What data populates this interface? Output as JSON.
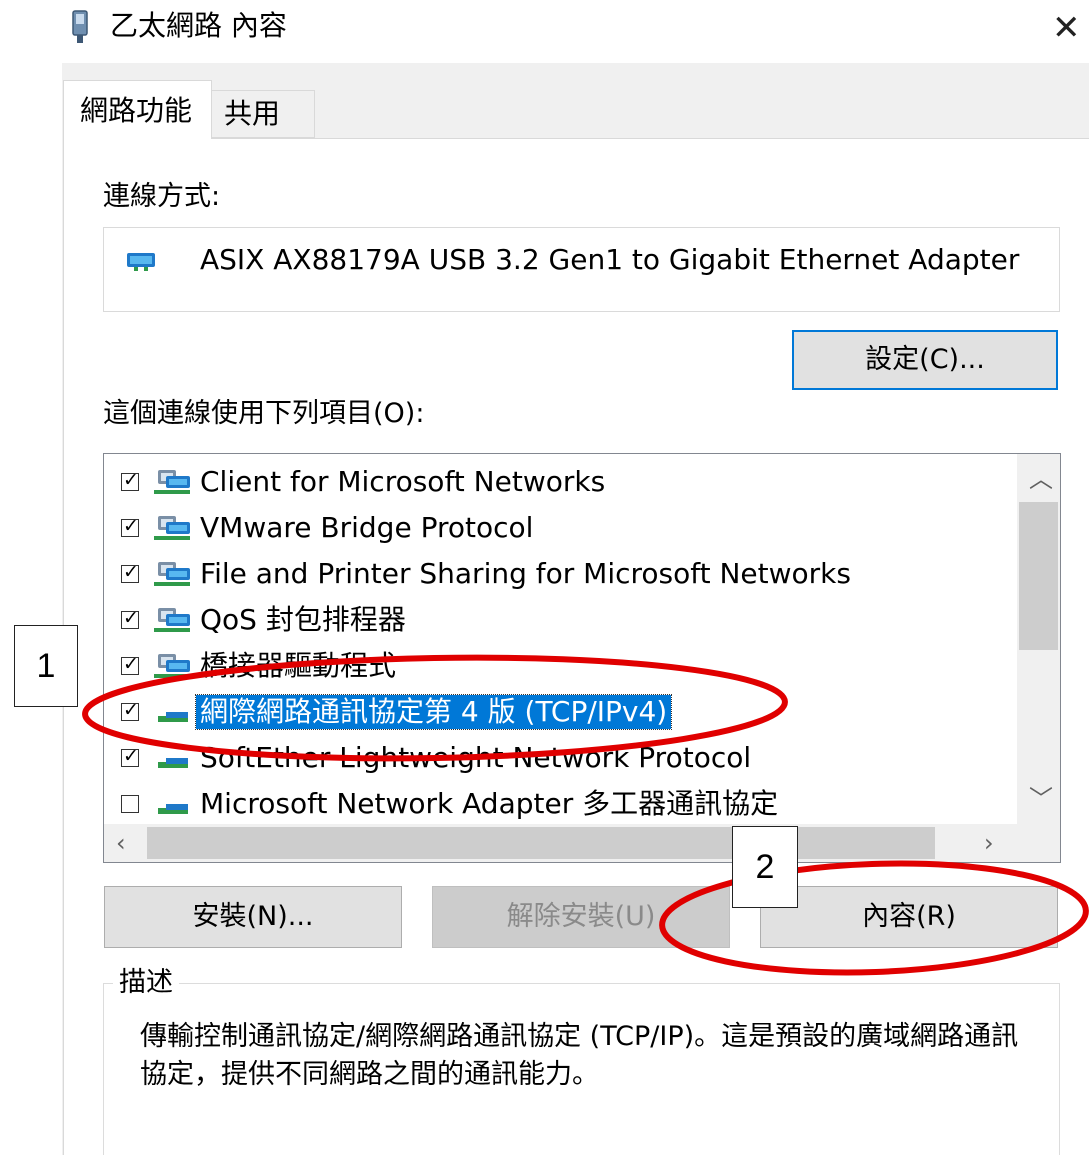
{
  "window": {
    "title": "乙太網路 內容"
  },
  "tabs": [
    {
      "label": "網路功能",
      "active": true
    },
    {
      "label": "共用",
      "active": false
    }
  ],
  "connect_using": {
    "label": "連線方式:",
    "adapter": "ASIX AX88179A USB 3.2 Gen1 to Gigabit Ethernet Adapter",
    "configure_button": "設定(C)..."
  },
  "items_section": {
    "label": "這個連線使用下列項目(O):",
    "items": [
      {
        "label": "Client for Microsoft Networks",
        "checked": true,
        "icon": "network-client-icon",
        "selected": false
      },
      {
        "label": "VMware Bridge Protocol",
        "checked": true,
        "icon": "network-client-icon",
        "selected": false
      },
      {
        "label": "File and Printer Sharing for Microsoft Networks",
        "checked": true,
        "icon": "network-client-icon",
        "selected": false
      },
      {
        "label": "QoS 封包排程器",
        "checked": true,
        "icon": "network-client-icon",
        "selected": false
      },
      {
        "label": "橋接器驅動程式",
        "checked": true,
        "icon": "network-client-icon",
        "selected": false
      },
      {
        "label": "網際網路通訊協定第 4 版 (TCP/IPv4)",
        "checked": true,
        "icon": "protocol-icon",
        "selected": true
      },
      {
        "label": "SoftEther Lightweight Network Protocol",
        "checked": true,
        "icon": "protocol-icon",
        "selected": false
      },
      {
        "label": "Microsoft Network Adapter 多工器通訊協定",
        "checked": false,
        "icon": "protocol-icon",
        "selected": false
      }
    ]
  },
  "buttons": {
    "install": "安裝(N)...",
    "uninstall": "解除安裝(U)",
    "properties": "內容(R)"
  },
  "description": {
    "legend": "描述",
    "text": "傳輸控制通訊協定/網際網路通訊協定 (TCP/IP)。這是預設的廣域網路通訊協定，提供不同網路之間的通訊能力。"
  },
  "annotations": {
    "marker_1": "1",
    "marker_2": "2",
    "highlight_color": "#e00000"
  },
  "colors": {
    "selection": "#0078d7",
    "focus_border": "#0078d7",
    "dialog_bg": "#f0f0f0"
  }
}
